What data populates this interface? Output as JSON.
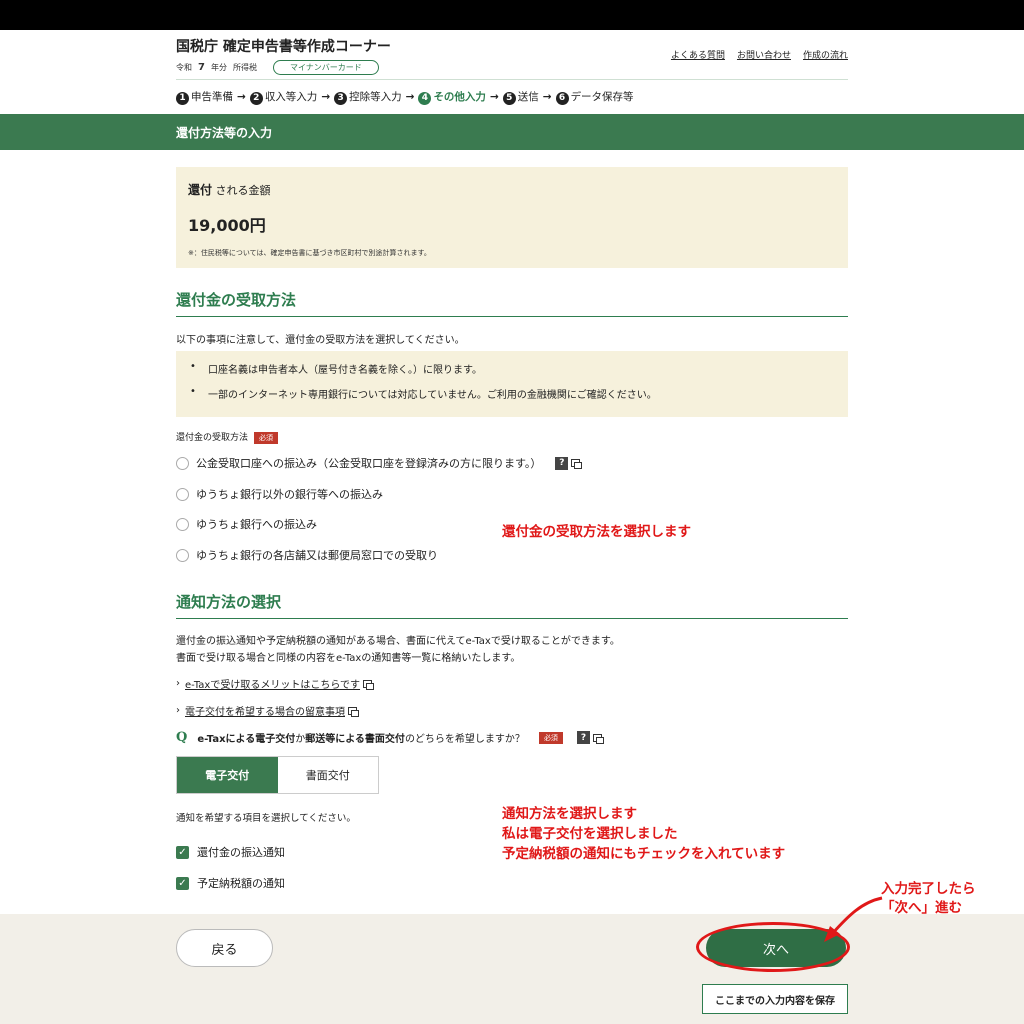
{
  "header": {
    "site_title": "国税庁 確定申告書等作成コーナー",
    "era": "令和",
    "year": "7",
    "year_suffix": "年分",
    "tax_type": "所得税",
    "auth_method": "マイナンバーカード",
    "links": [
      "よくある質問",
      "お問い合わせ",
      "作成の流れ"
    ]
  },
  "steps": [
    {
      "num": "1",
      "label": "申告準備"
    },
    {
      "num": "2",
      "label": "収入等入力"
    },
    {
      "num": "3",
      "label": "控除等入力"
    },
    {
      "num": "4",
      "label": "その他入力",
      "active": true
    },
    {
      "num": "5",
      "label": "送信"
    },
    {
      "num": "6",
      "label": "データ保存等"
    }
  ],
  "page_title": "還付方法等の入力",
  "refund": {
    "label_strong": "還付",
    "label_rest": "される金額",
    "amount": "19,000円",
    "note": "※：住民税等については、確定申告書に基づき市区町村で別途計算されます。"
  },
  "receipt_section": {
    "heading": "還付金の受取方法",
    "intro": "以下の事項に注意して、還付金の受取方法を選択してください。",
    "notes": [
      "口座名義は申告者本人（屋号付き名義を除く。）に限ります。",
      "一部のインターネット専用銀行については対応していません。ご利用の金融機関にご確認ください。"
    ],
    "field_label": "還付金の受取方法",
    "required": "必須",
    "options": [
      "公金受取口座への振込み（公金受取口座を登録済みの方に限ります。）",
      "ゆうちょ銀行以外の銀行等への振込み",
      "ゆうちょ銀行への振込み",
      "ゆうちょ銀行の各店舗又は郵便局窓口での受取り"
    ],
    "help_icon": "?"
  },
  "notify_section": {
    "heading": "通知方法の選択",
    "desc1": "還付金の振込通知や予定納税額の通知がある場合、書面に代えてe-Taxで受け取ることができます。",
    "desc2": "書面で受け取る場合と同様の内容をe-Taxの通知書等一覧に格納いたします。",
    "link1": "e-Taxで受け取るメリットはこちらです",
    "link2": "電子交付を希望する場合の留意事項",
    "q_mark": "Q",
    "q_part1": "e-Taxによる電子交付",
    "q_part2": " か ",
    "q_part3": "郵送等による書面交付",
    "q_part4": " のどちらを希望しますか？",
    "required": "必須",
    "help_icon": "?",
    "toggle_on": "電子交付",
    "toggle_off": "書面交付",
    "select_prompt": "通知を希望する項目を選択してください。",
    "checkboxes": [
      "還付金の振込通知",
      "予定納税額の通知"
    ],
    "check_mark": "✓"
  },
  "annotations": {
    "a1": "還付金の受取方法を選択します",
    "a2_1": "通知方法を選択します",
    "a2_2": "私は電子交付を選択しました",
    "a2_3": "予定納税額の通知にもチェックを入れています",
    "a3_1": "入力完了したら",
    "a3_2": "「次へ」進む"
  },
  "footer": {
    "back": "戻る",
    "next": "次へ",
    "save": "ここまでの入力内容を保存"
  },
  "colors": {
    "brand_green": "#3b7a50",
    "annotation_red": "#e01818",
    "note_bg": "#f6f1dc"
  }
}
